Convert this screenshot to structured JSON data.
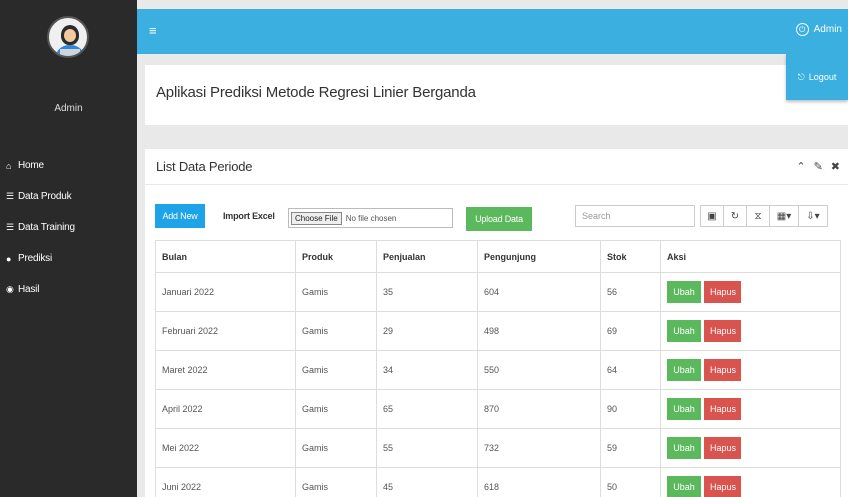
{
  "app": {
    "title": "Aplikasi Prediksi Metode Regresi Linier Berganda",
    "user": "Admin"
  },
  "topbar": {
    "menu_icon": "hamburger-icon",
    "admin_label": "Admin",
    "logout_label": "Logout"
  },
  "sidebar": {
    "items": [
      {
        "icon": "home-icon",
        "glyph": "⌂",
        "label": "Home"
      },
      {
        "icon": "list-icon",
        "glyph": "☰",
        "label": "Data Produk"
      },
      {
        "icon": "list-icon",
        "glyph": "☰",
        "label": "Data Training"
      },
      {
        "icon": "globe-icon",
        "glyph": "●",
        "label": "Prediksi"
      },
      {
        "icon": "eye-icon",
        "glyph": "◉",
        "label": "Hasil"
      }
    ]
  },
  "panel": {
    "title": "List Data Periode",
    "add_label": "Add New",
    "import_label": "Import Excel",
    "choose_label": "Choose File",
    "no_file": "No file chosen",
    "upload_label": "Upload Data",
    "search_placeholder": "Search"
  },
  "table": {
    "headers": [
      "Bulan",
      "Produk",
      "Penjualan",
      "Pengunjung",
      "Stok",
      "Aksi"
    ],
    "edit_label": "Ubah",
    "delete_label": "Hapus",
    "rows": [
      [
        "Januari 2022",
        "Gamis",
        "35",
        "604",
        "56"
      ],
      [
        "Februari 2022",
        "Gamis",
        "29",
        "498",
        "69"
      ],
      [
        "Maret 2022",
        "Gamis",
        "34",
        "550",
        "64"
      ],
      [
        "April 2022",
        "Gamis",
        "65",
        "870",
        "90"
      ],
      [
        "Mei 2022",
        "Gamis",
        "55",
        "732",
        "59"
      ],
      [
        "Juni 2022",
        "Gamis",
        "45",
        "618",
        "50"
      ]
    ]
  },
  "colors": {
    "primary": "#3bb0e0",
    "success": "#5cb85c",
    "danger": "#d9534f",
    "sidebar": "#2a2a2a"
  }
}
